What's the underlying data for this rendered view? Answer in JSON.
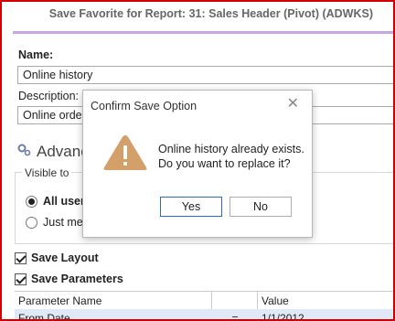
{
  "window": {
    "title": "Save Favorite for Report: 31: Sales Header (Pivot) (ADWKS)"
  },
  "form": {
    "name_label": "Name:",
    "name_value": "Online history",
    "description_label": "Description:",
    "description_value": "Online orders"
  },
  "advanced": {
    "heading": "Advanced",
    "visible_to_label": "Visible to",
    "options": [
      {
        "label": "All users",
        "selected": true
      },
      {
        "label": "Just me",
        "selected": false
      }
    ]
  },
  "checks": {
    "save_layout": "Save Layout",
    "save_parameters": "Save Parameters"
  },
  "parameters_table": {
    "columns": [
      "Parameter Name",
      "",
      "Value"
    ],
    "rows": [
      {
        "name": "From Date",
        "op": "=",
        "value": "1/1/2012"
      }
    ]
  },
  "dialog": {
    "title": "Confirm Save Option",
    "line1": "Online history already exists.",
    "line2": "Do you want to replace it?",
    "yes": "Yes",
    "no": "No",
    "warning_color": "#d4a06a"
  }
}
